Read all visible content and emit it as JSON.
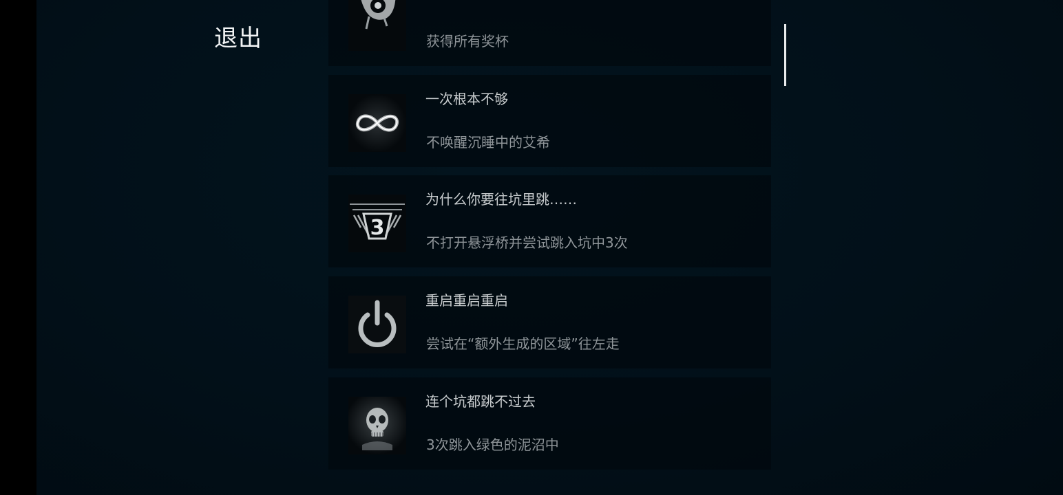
{
  "exit_label": "退出",
  "achievements": [
    {
      "icon": "trophy-splash-icon",
      "title": "",
      "desc": "获得所有奖杯"
    },
    {
      "icon": "infinity-icon",
      "title": "一次根本不够",
      "desc": "不唤醒沉睡中的艾希"
    },
    {
      "icon": "pit-three-icon",
      "title": "为什么你要往坑里跳……",
      "desc": "不打开悬浮桥并尝试跳入坑中3次",
      "icon_text": "3"
    },
    {
      "icon": "power-icon",
      "title": "重启重启重启",
      "desc": "尝试在“额外生成的区域”往左走"
    },
    {
      "icon": "skull-icon",
      "title": "连个坑都跳不过去",
      "desc": "3次跳入绿色的泥沼中"
    }
  ],
  "colors": {
    "background": "#021019",
    "card": "#01090e",
    "title_text": "#c8ccce",
    "desc_text": "#8f9599",
    "exit_text": "#f2f4f5"
  }
}
